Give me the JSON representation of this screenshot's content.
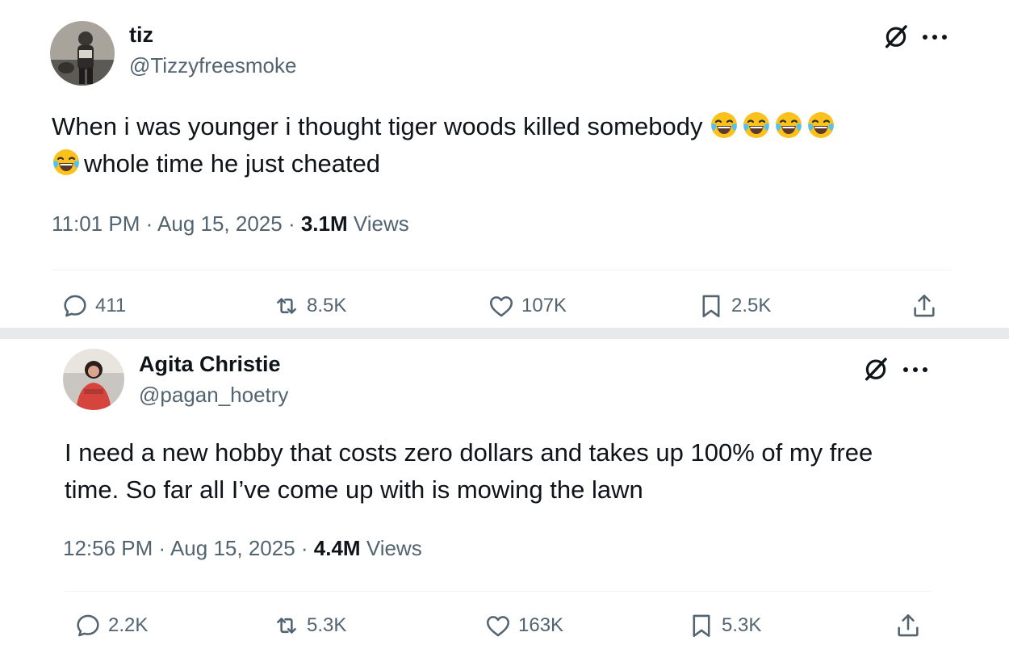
{
  "tweets": [
    {
      "author_name": "tiz",
      "handle": "@Tizzyfreesmoke",
      "text_line1": "When i was younger i thought tiger woods killed somebody",
      "text_line2": "whole time he just cheated",
      "emoji": "face-with-tears-of-joy",
      "time": "11:01 PM",
      "date": "Aug 15, 2025",
      "views_count": "3.1M",
      "views_label": "Views",
      "replies": "411",
      "reposts": "8.5K",
      "likes": "107K",
      "bookmarks": "2.5K"
    },
    {
      "author_name": "Agita Christie",
      "handle": "@pagan_hoetry",
      "text_line1": "I need a new hobby that costs zero dollars and takes up 100% of my free",
      "text_line2": "time. So far all I’ve come up with is mowing the lawn",
      "time": "12:56 PM",
      "date": "Aug 15, 2025",
      "views_count": "4.4M",
      "views_label": "Views",
      "replies": "2.2K",
      "reposts": "5.3K",
      "likes": "163K",
      "bookmarks": "5.3K"
    }
  ],
  "colors": {
    "text": "#0f1419",
    "secondary": "#536471",
    "divider": "#eff3f4",
    "separator": "#e7e9ea"
  },
  "icons": [
    "grok-icon",
    "more-icon",
    "reply-icon",
    "repost-icon",
    "like-icon",
    "bookmark-icon",
    "share-icon"
  ]
}
